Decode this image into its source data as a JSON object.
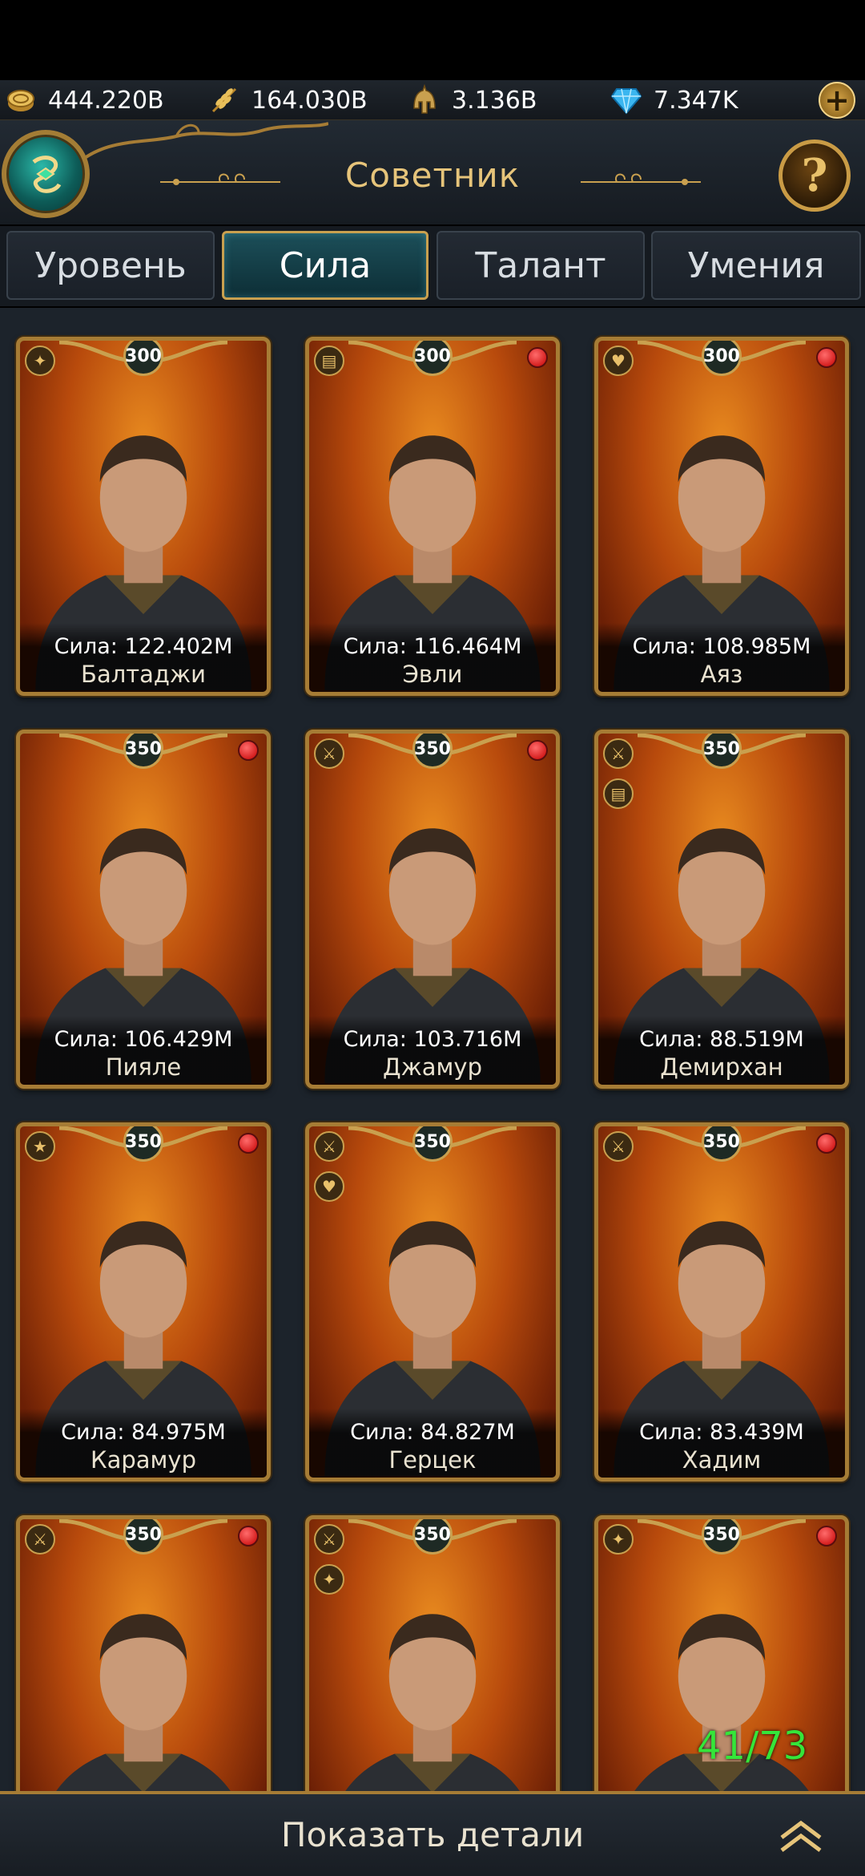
{
  "resources": [
    {
      "icon": "gold-coins-icon",
      "value": "444.220B"
    },
    {
      "icon": "wheat-icon",
      "value": "164.030B"
    },
    {
      "icon": "soldier-helmet-icon",
      "value": "3.136B"
    },
    {
      "icon": "diamond-icon",
      "value": "7.347K"
    }
  ],
  "header": {
    "title": "Советник"
  },
  "tabs": [
    {
      "label": "Уровень",
      "active": false
    },
    {
      "label": "Сила",
      "active": true
    },
    {
      "label": "Талант",
      "active": false
    },
    {
      "label": "Умения",
      "active": false
    }
  ],
  "advisors": [
    {
      "name": "Балтаджи",
      "power": "Сила: 122.402M",
      "level": "300",
      "skills": [
        "handshake-icon"
      ],
      "notify": false
    },
    {
      "name": "Эвли",
      "power": "Сила: 116.464M",
      "level": "300",
      "skills": [
        "book-icon"
      ],
      "notify": true
    },
    {
      "name": "Аяз",
      "power": "Сила: 108.985M",
      "level": "300",
      "skills": [
        "heart-icon"
      ],
      "notify": true
    },
    {
      "name": "Пияле",
      "power": "Сила: 106.429M",
      "level": "350",
      "skills": [],
      "notify": true
    },
    {
      "name": "Джамур",
      "power": "Сила: 103.716M",
      "level": "350",
      "skills": [
        "swords-icon"
      ],
      "notify": true
    },
    {
      "name": "Демирхан",
      "power": "Сила: 88.519M",
      "level": "350",
      "skills": [
        "swords-icon",
        "book-icon"
      ],
      "notify": false
    },
    {
      "name": "Карамур",
      "power": "Сила: 84.975M",
      "level": "350",
      "skills": [
        "star-icon"
      ],
      "notify": true
    },
    {
      "name": "Герцек",
      "power": "Сила: 84.827M",
      "level": "350",
      "skills": [
        "swords-icon",
        "heart-icon"
      ],
      "notify": false
    },
    {
      "name": "Хадим",
      "power": "Сила: 83.439M",
      "level": "350",
      "skills": [
        "swords-icon"
      ],
      "notify": true
    },
    {
      "name": "",
      "power": "",
      "level": "350",
      "skills": [
        "swords-icon"
      ],
      "notify": true
    },
    {
      "name": "",
      "power": "",
      "level": "350",
      "skills": [
        "swords-icon",
        "handshake-icon"
      ],
      "notify": false
    },
    {
      "name": "",
      "power": "",
      "level": "350",
      "skills": [
        "handshake-icon"
      ],
      "notify": true
    }
  ],
  "counter": "41/73",
  "footer": {
    "label": "Показать детали"
  },
  "colors": {
    "gold": "#c9a04f",
    "accent_teal": "#1c4f59",
    "counter_green": "#35e53a",
    "notify_red": "#c40000"
  }
}
